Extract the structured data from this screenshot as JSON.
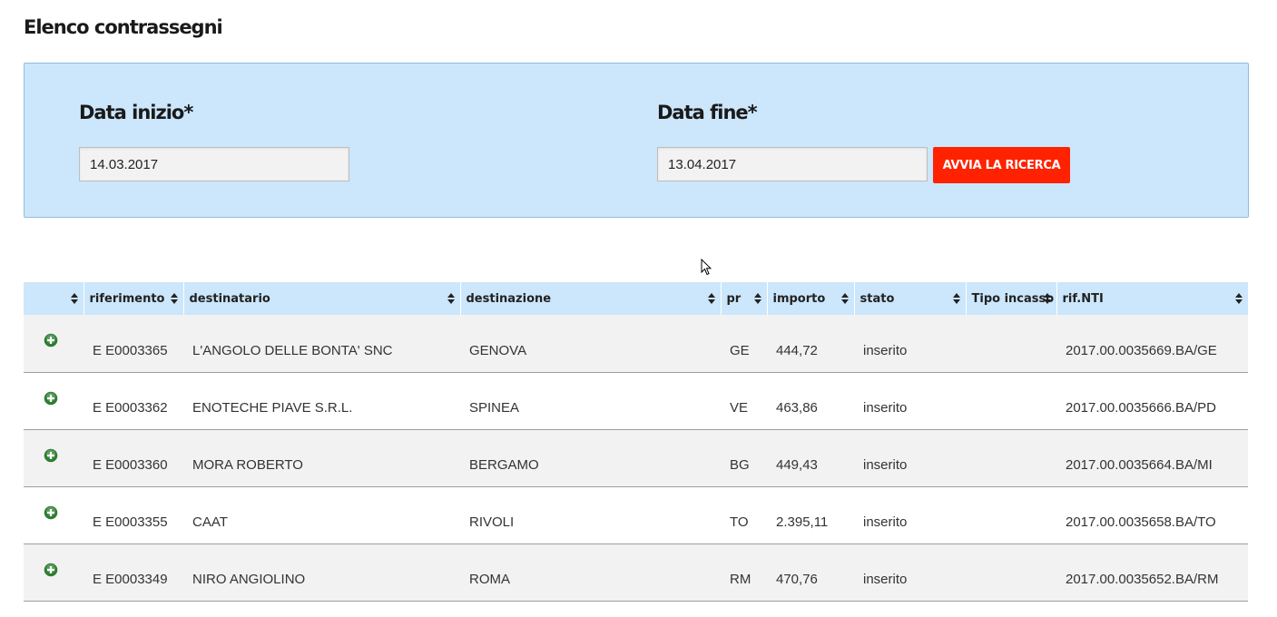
{
  "page": {
    "title": "Elenco contrassegni"
  },
  "search": {
    "start_label": "Data inizio*",
    "start_value": "14.03.2017",
    "end_label": "Data fine*",
    "end_value": "13.04.2017",
    "button_label": "AVVIA LA RICERCA"
  },
  "colors": {
    "panel_bg": "#cce6fb",
    "button_red": "#ff2200",
    "expand_green": "#2e7d32",
    "row_alt": "#f2f2f2"
  },
  "table": {
    "headers": [
      "",
      "riferimento",
      "destinatario",
      "destinazione",
      "pr",
      "importo",
      "stato",
      "Tipo incasso",
      "rif.NTI"
    ],
    "rows": [
      {
        "riferimento": "E E0003365",
        "destinatario": "L'ANGOLO DELLE BONTA' SNC",
        "destinazione": "GENOVA",
        "pr": "GE",
        "importo": "444,72",
        "stato": "inserito",
        "tipo_incasso": "",
        "rif_nti": "2017.00.0035669.BA/GE"
      },
      {
        "riferimento": "E E0003362",
        "destinatario": "ENOTECHE PIAVE S.R.L.",
        "destinazione": "SPINEA",
        "pr": "VE",
        "importo": "463,86",
        "stato": "inserito",
        "tipo_incasso": "",
        "rif_nti": "2017.00.0035666.BA/PD"
      },
      {
        "riferimento": "E E0003360",
        "destinatario": "MORA ROBERTO",
        "destinazione": "BERGAMO",
        "pr": "BG",
        "importo": "449,43",
        "stato": "inserito",
        "tipo_incasso": "",
        "rif_nti": "2017.00.0035664.BA/MI"
      },
      {
        "riferimento": "E E0003355",
        "destinatario": "CAAT",
        "destinazione": "RIVOLI",
        "pr": "TO",
        "importo": "2.395,11",
        "stato": "inserito",
        "tipo_incasso": "",
        "rif_nti": "2017.00.0035658.BA/TO"
      },
      {
        "riferimento": "E E0003349",
        "destinatario": "NIRO ANGIOLINO",
        "destinazione": "ROMA",
        "pr": "RM",
        "importo": "470,76",
        "stato": "inserito",
        "tipo_incasso": "",
        "rif_nti": "2017.00.0035652.BA/RM"
      }
    ]
  }
}
